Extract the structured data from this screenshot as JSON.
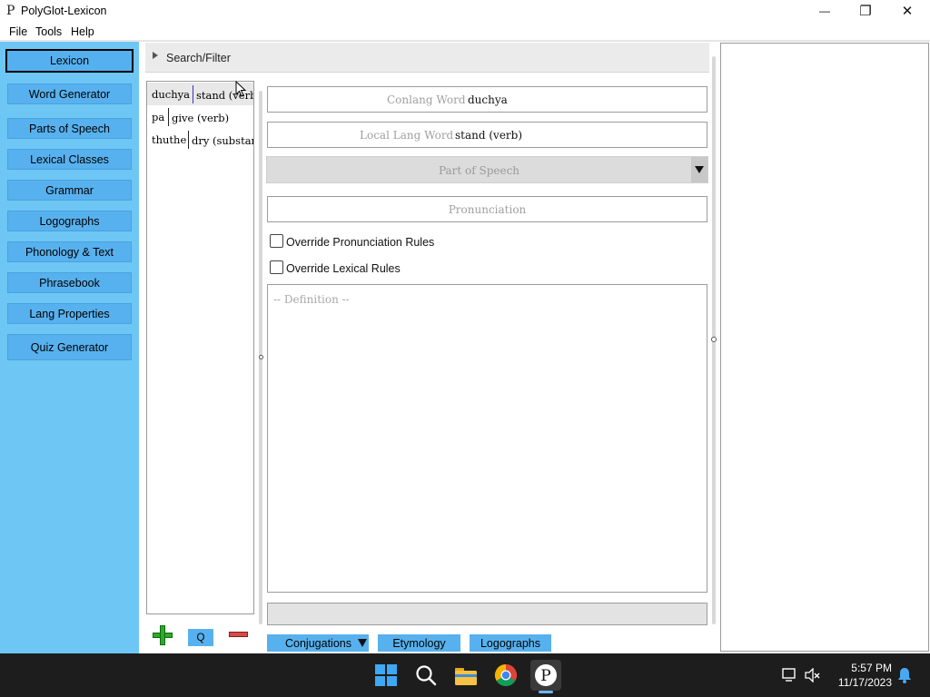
{
  "window": {
    "title": "PolyGlot-Lexicon",
    "icon_glyph": "P",
    "minimize_glyph": "—",
    "maximize_glyph": "❐",
    "close_glyph": "✕"
  },
  "menu": {
    "file": "File",
    "tools": "Tools",
    "help": "Help"
  },
  "sidebar": {
    "items": [
      {
        "label": "Lexicon",
        "active": true
      },
      {
        "label": "Word Generator"
      },
      {
        "label": "Parts of Speech"
      },
      {
        "label": "Lexical Classes"
      },
      {
        "label": "Grammar"
      },
      {
        "label": "Logographs"
      },
      {
        "label": "Phonology & Text"
      },
      {
        "label": "Phrasebook"
      },
      {
        "label": "Lang Properties"
      },
      {
        "label": "Quiz Generator"
      }
    ]
  },
  "search": {
    "label": "Search/Filter"
  },
  "words": [
    {
      "conlang": "duchya",
      "local": "stand (verb)",
      "selected": true
    },
    {
      "conlang": "pa",
      "local": "give (verb)"
    },
    {
      "conlang": "thuthe",
      "local": "dry (substan"
    }
  ],
  "detail": {
    "conlang_placeholder": "Conlang Word",
    "conlang_value": "duchya",
    "local_placeholder": "Local Lang Word",
    "local_value": "stand (verb)",
    "part_of_speech_placeholder": "Part of Speech",
    "pronunciation_placeholder": "Pronunciation",
    "override_pronunciation_label": "Override Pronunciation Rules",
    "override_lexical_label": "Override Lexical Rules",
    "definition_placeholder": "-- Definition --"
  },
  "list_actions": {
    "quick_label": "Q"
  },
  "tabs": {
    "conjugations": "Conjugations",
    "etymology": "Etymology",
    "logographs": "Logographs"
  },
  "taskbar": {
    "time": "5:57 PM",
    "date": "11/17/2023",
    "pinned_icons": [
      "start-icon",
      "search-icon",
      "file-explorer-icon",
      "chrome-icon",
      "polyglot-icon"
    ],
    "tray_icons": [
      "network-icon",
      "volume-muted-icon",
      "notification-bell-icon"
    ]
  },
  "colors": {
    "sidebar_bg": "#6ec6f5",
    "button_bg": "#57b1ee",
    "taskbar_bg": "#1d1d1d",
    "add_green": "#2ea82e",
    "delete_red": "#d94a4a"
  }
}
